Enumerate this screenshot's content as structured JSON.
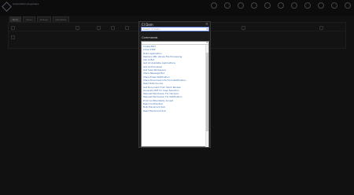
{
  "header": {
    "logo_text": "Automation Anywhere",
    "icons": [
      "star-badge-icon",
      "refresh-icon",
      "clock-icon",
      "grid-icon",
      "magic-icon",
      "bell-icon",
      "document-icon",
      "lightbulb-icon",
      "settings-icon",
      "help-icon",
      "power-icon"
    ]
  },
  "subbar": {
    "tabs": [
      "Back",
      "Save",
      "Debug",
      "Variables"
    ]
  },
  "modal": {
    "title": "CI Dem",
    "ci_placeholder": "Select CI Dem...",
    "commands_label": "Commands",
    "list": [
      "Create BOT",
      "Close STEP",
      "Build Application",
      "Replace XML Values File Processing",
      "Ask AI Bot",
      "Get All Available Applications",
      "Get All Processes",
      "Get Case Workspace",
      "Share Message Bot",
      "Share Email Notification",
      "Share Document Info From Notification",
      "Read Data Source",
      "Get Document From Stock Review",
      "Generate PDF for Case Selection",
      "Request Permission For Decision",
      "Request Permission For Notification",
      "Print Confidentiality Accept",
      "Read Confidential",
      "Bulk Placement Sub",
      "Read Placement Sub"
    ]
  },
  "colors": {
    "link": "#3a6fb0",
    "focus": "#5b7fd8"
  }
}
